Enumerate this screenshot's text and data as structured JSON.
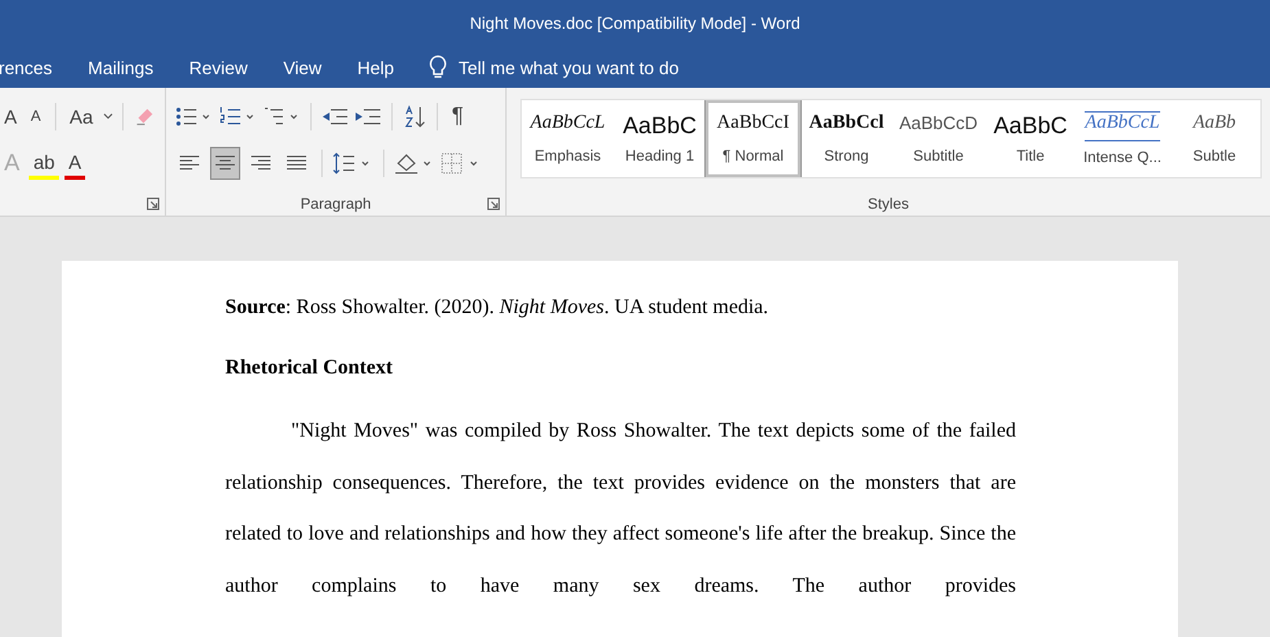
{
  "window": {
    "title": "Night Moves.doc [Compatibility Mode]  -  Word"
  },
  "tabs": [
    {
      "label": "rences"
    },
    {
      "label": "Mailings"
    },
    {
      "label": "Review"
    },
    {
      "label": "View"
    },
    {
      "label": "Help"
    }
  ],
  "search": {
    "placeholder": "Tell me what you want to do"
  },
  "font_group": {
    "grow": "A",
    "shrink": "A",
    "change_case": "Aa",
    "text_effects": "A",
    "highlight": "ab",
    "font_color": "A"
  },
  "paragraph_group": {
    "label": "Paragraph",
    "show_marks": "¶",
    "alignments": [
      {
        "kind": "left",
        "selected": false
      },
      {
        "kind": "center",
        "selected": true
      },
      {
        "kind": "right",
        "selected": false
      },
      {
        "kind": "justify",
        "selected": false
      }
    ]
  },
  "styles_group": {
    "label": "Styles",
    "styles": [
      {
        "sample": "AaBbCcL",
        "label": "Emphasis",
        "kind": "emphasis",
        "selected": false
      },
      {
        "sample": "AaBbC",
        "label": "Heading 1",
        "kind": "heading",
        "selected": false
      },
      {
        "sample": "AaBbCcI",
        "label": "¶ Normal",
        "kind": "normal",
        "selected": true
      },
      {
        "sample": "AaBbCcl",
        "label": "Strong",
        "kind": "strong",
        "selected": false
      },
      {
        "sample": "AaBbCcD",
        "label": "Subtitle",
        "kind": "subtitle",
        "selected": false
      },
      {
        "sample": "AaBbC",
        "label": "Title",
        "kind": "title",
        "selected": false
      },
      {
        "sample": "AaBbCcL",
        "label": "Intense Q...",
        "kind": "intense",
        "selected": false
      },
      {
        "sample": "AaBb",
        "label": "Subtle",
        "kind": "subtle",
        "selected": false
      }
    ]
  },
  "document": {
    "source": "**Source**:  Ross Showalter. (2020). *Night Moves*. UA student media.",
    "heading": "Rhetorical Context",
    "paragraph": "\"Night Moves\" was compiled by Ross Showalter. The text depicts some of the failed relationship consequences. Therefore, the text provides evidence on the monsters that are related to love and relationships and how they affect someone's life after the breakup. Since the author complains to have many sex dreams. The author provides"
  }
}
